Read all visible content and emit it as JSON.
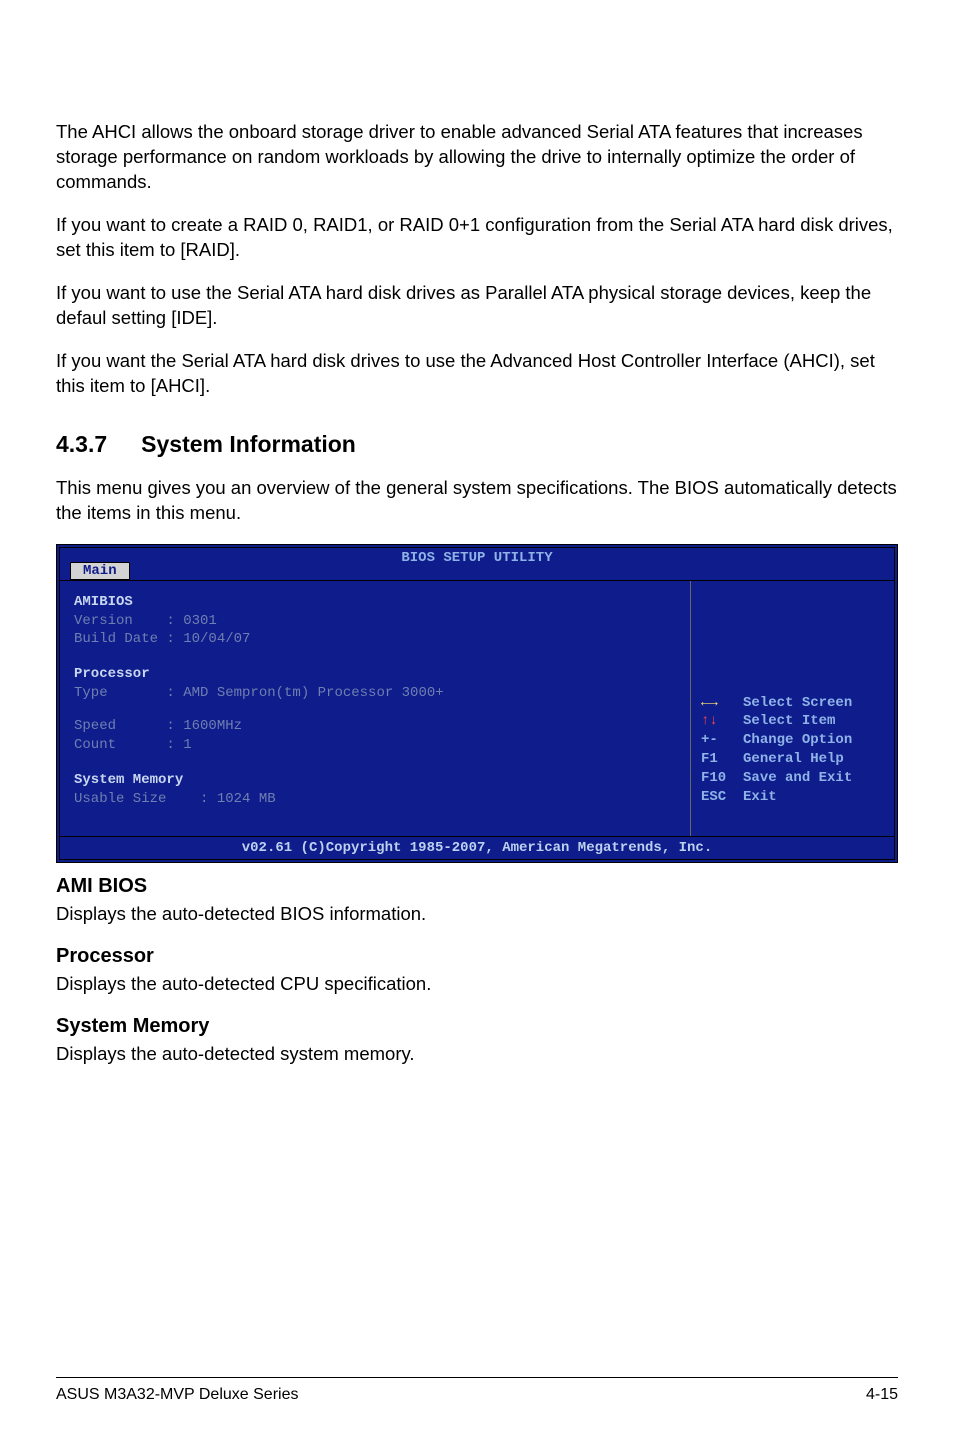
{
  "para1": "The AHCI allows the onboard storage driver to enable advanced Serial ATA features that increases storage performance on random workloads by allowing the drive to internally optimize the order of commands.",
  "para2": "If you want to create a RAID 0, RAID1, or RAID 0+1 configuration from the Serial ATA hard disk drives, set this item to [RAID].",
  "para3": "If you want to use the Serial ATA hard disk drives as Parallel ATA physical storage devices, keep the defaul setting [IDE].",
  "para4": "If you want the Serial ATA hard disk drives to use the Advanced Host Controller Interface (AHCI), set this item to [AHCI].",
  "section_num": "4.3.7",
  "section_title": "System Information",
  "section_intro": "This menu gives you an overview of the general system specifications. The BIOS automatically detects the items in this menu.",
  "bios": {
    "title": "BIOS SETUP UTILITY",
    "tab": "Main",
    "amibios_h": "AMIBIOS",
    "amibios_version": "Version    : 0301",
    "amibios_build": "Build Date : 10/04/07",
    "processor_h": "Processor",
    "processor_type": "Type       : AMD Sempron(tm) Processor 3000+",
    "processor_speed": "Speed      : 1600MHz",
    "processor_count": "Count      : 1",
    "sysmem_h": "System Memory",
    "sysmem_usable": "Usable Size    : 1024 MB",
    "help": {
      "select_screen": "Select Screen",
      "select_item": "Select Item",
      "change_option": "Change Option",
      "general_help": "General Help",
      "save_exit": "Save and Exit",
      "exit": "Exit",
      "key_pm": "+-",
      "key_f1": "F1",
      "key_f10": "F10",
      "key_esc": "ESC"
    },
    "footer": "v02.61 (C)Copyright 1985-2007, American Megatrends, Inc."
  },
  "amibios": {
    "heading": "AMI BIOS",
    "text": "Displays the auto-detected BIOS information."
  },
  "processor": {
    "heading": "Processor",
    "text": "Displays the auto-detected CPU specification."
  },
  "sysmem": {
    "heading": "System Memory",
    "text": "Displays the auto-detected system memory."
  },
  "page_footer_left": "ASUS M3A32-MVP Deluxe Series",
  "page_footer_right": "4-15"
}
